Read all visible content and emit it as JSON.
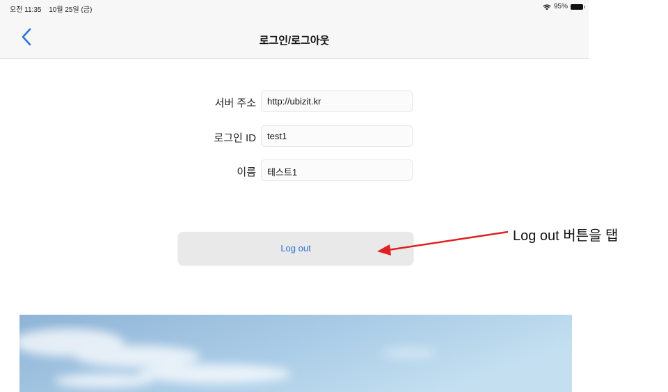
{
  "status_bar": {
    "time": "오전 11:35",
    "date": "10월 25일 (금)",
    "battery": "95%",
    "icons": [
      "wifi-icon",
      "battery-icon"
    ]
  },
  "nav": {
    "title": "로그인/로그아웃",
    "back_icon": "chevron-left-icon",
    "accent_color": "#2a72d6"
  },
  "form": {
    "fields": [
      {
        "label": "서버 주소",
        "value": "http://ubizit.kr"
      },
      {
        "label": "로그인 ID",
        "value": "test1"
      },
      {
        "label": "이름",
        "value": "테스트1"
      }
    ]
  },
  "logout_button": {
    "label": "Log out",
    "color": "#2a72d6"
  },
  "annotation": {
    "text": "Log out 버튼을 탭",
    "arrow_color": "#e02020"
  }
}
